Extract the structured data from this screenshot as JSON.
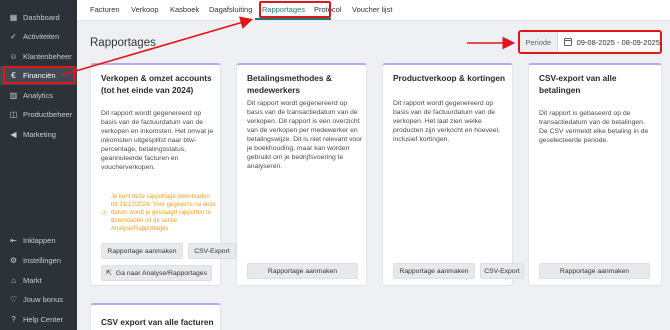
{
  "sidebar": {
    "items": [
      {
        "label": "Dashboard",
        "icon": "grid-icon"
      },
      {
        "label": "Activiteiten",
        "icon": "activity-icon"
      },
      {
        "label": "Klantenbeheer",
        "icon": "user-icon"
      },
      {
        "label": "Financiën",
        "icon": "euro-icon",
        "active": true
      },
      {
        "label": "Analytics",
        "icon": "chart-icon"
      },
      {
        "label": "Productbeheer",
        "icon": "box-icon"
      },
      {
        "label": "Marketing",
        "icon": "megaphone-icon"
      }
    ],
    "bottom_items": [
      {
        "label": "Inklappen",
        "icon": "collapse-icon"
      },
      {
        "label": "Instellingen",
        "icon": "gear-icon"
      },
      {
        "label": "Markt",
        "icon": "shop-icon"
      },
      {
        "label": "Jouw bonus",
        "icon": "heart-icon"
      },
      {
        "label": "Help Center",
        "icon": "help-icon"
      }
    ]
  },
  "tabs": [
    "Facturen",
    "Verkoop",
    "Kasboek",
    "Dagafsluiting",
    "Rapportages",
    "Protocol",
    "Voucher lijst"
  ],
  "active_tab": "Rapportages",
  "page": {
    "title": "Rapportages",
    "period_label": "Periode",
    "period_value": "09-08-2025 - 08-09-2025"
  },
  "cards": [
    {
      "title": "Verkopen & omzet accounts (tot het einde van 2024)",
      "description": "Dit rapport wordt gegenereerd op basis van de factuurdatum van de verkopen en inkomsten. Het omvat je inkomsten uitgesplitst naar btw-percentage, betalingsstatus, geannuleerde facturen en voucherverkopen.",
      "warning": "Je kunt deze rapportage downloaden tot 31/12/2024. Voor gegevens na deze datum wordt je gevraagd rapporten te downloaden uit de sectie Analyse/Rapportages",
      "buttons": [
        "Rapportage aanmaken",
        "CSV-Export",
        "Ga naar Analyse/Rapportages"
      ]
    },
    {
      "title": "Betalingsmethodes & medewerkers",
      "description": "Dit rapport wordt gegenereerd op basis van de transactiedatum van de verkopen. Dit rapport is een overzicht van de verkopen per medewerker en betalingswijze. Dit is niet relevant voor je boekhouding, maar kan worden gebruikt om je bedrijfsvoering te analyseren.",
      "buttons": [
        "Rapportage aanmaken"
      ]
    },
    {
      "title": "Productverkoop & kortingen",
      "description": "Dit rapport wordt gegenereerd op basis van de factuurdatum van de verkopen. Het laat zien welke producten zijn verkocht en hoeveel, inclusief kortingen.",
      "buttons": [
        "Rapportage aanmaken",
        "CSV-Export"
      ]
    },
    {
      "title": "CSV-export van alle betalingen",
      "description": "Dit rapport is gebaseerd op de transactiedatum van de betalingen. De CSV vermeldt elke betaling in de geselecteerde periode.",
      "buttons": [
        "Rapportage aanmaken"
      ]
    },
    {
      "title": "CSV export van alle facturen",
      "description": "",
      "buttons": []
    }
  ],
  "colors": {
    "sidebar_bg": "#2d3239",
    "accent": "#1c7a70",
    "annotation_red": "#e0161b",
    "warning": "#f0a020",
    "card_top_border": "#b7a9f0"
  }
}
